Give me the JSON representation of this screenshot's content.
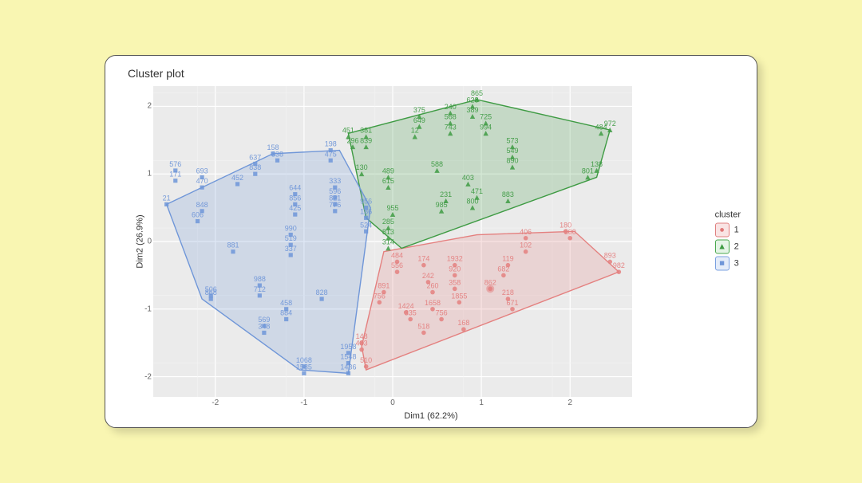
{
  "chart_data": {
    "type": "scatter",
    "title": "Cluster plot",
    "xlabel": "Dim1 (62.2%)",
    "ylabel": "Dim2 (26.9%)",
    "xlim": [
      -2.7,
      2.7
    ],
    "ylim": [
      -2.3,
      2.3
    ],
    "x_ticks": [
      -2,
      -1,
      0,
      1,
      2
    ],
    "y_ticks": [
      -2,
      -1,
      0,
      1,
      2
    ],
    "legend": {
      "title": "cluster",
      "items": [
        {
          "label": "1",
          "shape": "circle",
          "color": "#E4807F",
          "fill": "#F5C9C8"
        },
        {
          "label": "2",
          "shape": "triangle",
          "color": "#3E9B43",
          "fill": "#C6E6C8"
        },
        {
          "label": "3",
          "shape": "square",
          "color": "#6F96D8",
          "fill": "#C8D9F3"
        }
      ]
    },
    "hulls": {
      "1": [
        [
          -0.3,
          -1.9
        ],
        [
          2.55,
          -0.45
        ],
        [
          2.05,
          0.15
        ],
        [
          0.95,
          0.1
        ],
        [
          -0.1,
          -0.15
        ],
        [
          -0.35,
          -1.55
        ]
      ],
      "2": [
        [
          -0.5,
          1.6
        ],
        [
          0.95,
          2.1
        ],
        [
          2.45,
          1.65
        ],
        [
          2.3,
          0.95
        ],
        [
          0.1,
          -0.1
        ],
        [
          -0.3,
          0.35
        ]
      ],
      "3": [
        [
          -2.55,
          0.55
        ],
        [
          -1.35,
          1.3
        ],
        [
          -0.6,
          1.35
        ],
        [
          -0.25,
          0.5
        ],
        [
          -0.5,
          -1.95
        ],
        [
          -1.05,
          -1.9
        ],
        [
          -2.15,
          -0.85
        ]
      ]
    },
    "series": [
      {
        "name": "1",
        "color": "#E4807F",
        "shape": "circle",
        "points": [
          {
            "x": 0.05,
            "y": -0.3,
            "l": "484"
          },
          {
            "x": 0.05,
            "y": -0.45,
            "l": "556"
          },
          {
            "x": -0.1,
            "y": -0.75,
            "l": "891"
          },
          {
            "x": -0.15,
            "y": -0.9,
            "l": "756"
          },
          {
            "x": -0.35,
            "y": -1.5,
            "l": "148"
          },
          {
            "x": -0.35,
            "y": -1.6,
            "l": "483"
          },
          {
            "x": -0.3,
            "y": -1.85,
            "l": "510"
          },
          {
            "x": 0.15,
            "y": -1.05,
            "l": "1424"
          },
          {
            "x": 0.2,
            "y": -1.15,
            "l": "335"
          },
          {
            "x": 0.35,
            "y": -1.35,
            "l": "518"
          },
          {
            "x": 0.35,
            "y": -0.35,
            "l": "174"
          },
          {
            "x": 0.4,
            "y": -0.6,
            "l": "242"
          },
          {
            "x": 0.45,
            "y": -0.75,
            "l": "260"
          },
          {
            "x": 0.45,
            "y": -1.0,
            "l": "1658"
          },
          {
            "x": 0.55,
            "y": -1.15,
            "l": "756"
          },
          {
            "x": 0.7,
            "y": -0.35,
            "l": "1932"
          },
          {
            "x": 0.7,
            "y": -0.5,
            "l": "920"
          },
          {
            "x": 0.7,
            "y": -0.7,
            "l": "358"
          },
          {
            "x": 0.75,
            "y": -0.9,
            "l": "1855"
          },
          {
            "x": 0.8,
            "y": -1.3,
            "l": "168"
          },
          {
            "x": 1.1,
            "y": -0.7,
            "l": "862"
          },
          {
            "x": 1.25,
            "y": -0.5,
            "l": "682"
          },
          {
            "x": 1.3,
            "y": -0.35,
            "l": "119"
          },
          {
            "x": 1.3,
            "y": -0.85,
            "l": "218"
          },
          {
            "x": 1.35,
            "y": -1.0,
            "l": "671"
          },
          {
            "x": 1.5,
            "y": 0.05,
            "l": "406"
          },
          {
            "x": 1.5,
            "y": -0.15,
            "l": "102"
          },
          {
            "x": 1.95,
            "y": 0.15,
            "l": "180"
          },
          {
            "x": 2.0,
            "y": 0.05,
            "l": "300"
          },
          {
            "x": 2.45,
            "y": -0.3,
            "l": "893"
          },
          {
            "x": 2.55,
            "y": -0.45,
            "l": "982"
          }
        ]
      },
      {
        "name": "2",
        "color": "#3E9B43",
        "shape": "triangle",
        "points": [
          {
            "x": -0.05,
            "y": -0.1,
            "l": "314"
          },
          {
            "x": -0.05,
            "y": 0.05,
            "l": "813"
          },
          {
            "x": -0.05,
            "y": 0.2,
            "l": "285"
          },
          {
            "x": 0.0,
            "y": 0.4,
            "l": "955"
          },
          {
            "x": -0.05,
            "y": 0.8,
            "l": "615"
          },
          {
            "x": -0.05,
            "y": 0.95,
            "l": "489"
          },
          {
            "x": -0.35,
            "y": 1.0,
            "l": "130"
          },
          {
            "x": -0.3,
            "y": 1.4,
            "l": "839"
          },
          {
            "x": -0.3,
            "y": 1.55,
            "l": "381"
          },
          {
            "x": -0.45,
            "y": 1.4,
            "l": "296"
          },
          {
            "x": -0.5,
            "y": 1.55,
            "l": "451"
          },
          {
            "x": 0.25,
            "y": 1.55,
            "l": "12"
          },
          {
            "x": 0.3,
            "y": 1.7,
            "l": "649"
          },
          {
            "x": 0.3,
            "y": 1.85,
            "l": "375"
          },
          {
            "x": 0.5,
            "y": 1.05,
            "l": "588"
          },
          {
            "x": 0.55,
            "y": 0.45,
            "l": "985"
          },
          {
            "x": 0.6,
            "y": 0.6,
            "l": "231"
          },
          {
            "x": 0.65,
            "y": 1.75,
            "l": "568"
          },
          {
            "x": 0.65,
            "y": 1.9,
            "l": "240"
          },
          {
            "x": 0.65,
            "y": 1.6,
            "l": "743"
          },
          {
            "x": 0.85,
            "y": 0.85,
            "l": "403"
          },
          {
            "x": 0.9,
            "y": 1.85,
            "l": "389"
          },
          {
            "x": 0.9,
            "y": 2.0,
            "l": "628"
          },
          {
            "x": 0.95,
            "y": 2.1,
            "l": "865"
          },
          {
            "x": 0.9,
            "y": 0.5,
            "l": "800"
          },
          {
            "x": 0.95,
            "y": 0.65,
            "l": "471"
          },
          {
            "x": 1.05,
            "y": 1.6,
            "l": "994"
          },
          {
            "x": 1.05,
            "y": 1.75,
            "l": "725"
          },
          {
            "x": 1.3,
            "y": 0.6,
            "l": "883"
          },
          {
            "x": 1.35,
            "y": 1.25,
            "l": "549"
          },
          {
            "x": 1.35,
            "y": 1.4,
            "l": "573"
          },
          {
            "x": 1.35,
            "y": 1.1,
            "l": "890"
          },
          {
            "x": 2.2,
            "y": 0.95,
            "l": "801"
          },
          {
            "x": 2.3,
            "y": 1.05,
            "l": "138"
          },
          {
            "x": 2.35,
            "y": 1.6,
            "l": "484"
          },
          {
            "x": 2.45,
            "y": 1.65,
            "l": "972"
          }
        ]
      },
      {
        "name": "3",
        "color": "#6F96D8",
        "shape": "square",
        "points": [
          {
            "x": -2.55,
            "y": 0.55,
            "l": "21"
          },
          {
            "x": -2.45,
            "y": 0.9,
            "l": "171"
          },
          {
            "x": -2.45,
            "y": 1.05,
            "l": "576"
          },
          {
            "x": -2.15,
            "y": 0.8,
            "l": "470"
          },
          {
            "x": -2.15,
            "y": 0.95,
            "l": "693"
          },
          {
            "x": -2.2,
            "y": 0.3,
            "l": "606"
          },
          {
            "x": -2.15,
            "y": 0.45,
            "l": "848"
          },
          {
            "x": -2.05,
            "y": -0.8,
            "l": "506"
          },
          {
            "x": -2.05,
            "y": -0.85,
            "l": "868"
          },
          {
            "x": -1.8,
            "y": -0.15,
            "l": "881"
          },
          {
            "x": -1.75,
            "y": 0.85,
            "l": "452"
          },
          {
            "x": -1.55,
            "y": 1.0,
            "l": "838"
          },
          {
            "x": -1.55,
            "y": 1.15,
            "l": "637"
          },
          {
            "x": -1.5,
            "y": -0.65,
            "l": "988"
          },
          {
            "x": -1.5,
            "y": -0.8,
            "l": "712"
          },
          {
            "x": -1.45,
            "y": -1.25,
            "l": "569"
          },
          {
            "x": -1.45,
            "y": -1.35,
            "l": "348"
          },
          {
            "x": -1.35,
            "y": 1.3,
            "l": "158"
          },
          {
            "x": -1.3,
            "y": 1.2,
            "l": "338"
          },
          {
            "x": -1.1,
            "y": 0.55,
            "l": "856"
          },
          {
            "x": -1.1,
            "y": 0.7,
            "l": "644"
          },
          {
            "x": -1.1,
            "y": 0.4,
            "l": "425"
          },
          {
            "x": -1.15,
            "y": 0.1,
            "l": "990"
          },
          {
            "x": -1.15,
            "y": -0.05,
            "l": "519"
          },
          {
            "x": -1.15,
            "y": -0.2,
            "l": "337"
          },
          {
            "x": -1.2,
            "y": -1.0,
            "l": "458"
          },
          {
            "x": -1.2,
            "y": -1.15,
            "l": "884"
          },
          {
            "x": -1.0,
            "y": -1.85,
            "l": "1068"
          },
          {
            "x": -1.0,
            "y": -1.95,
            "l": "1585"
          },
          {
            "x": -0.8,
            "y": -0.85,
            "l": "828"
          },
          {
            "x": -0.7,
            "y": 1.35,
            "l": "198"
          },
          {
            "x": -0.7,
            "y": 1.2,
            "l": "475"
          },
          {
            "x": -0.65,
            "y": 0.8,
            "l": "333"
          },
          {
            "x": -0.65,
            "y": 0.65,
            "l": "596"
          },
          {
            "x": -0.65,
            "y": 0.55,
            "l": "821"
          },
          {
            "x": -0.65,
            "y": 0.45,
            "l": "776"
          },
          {
            "x": -0.5,
            "y": -1.65,
            "l": "1958"
          },
          {
            "x": -0.5,
            "y": -1.8,
            "l": "1548"
          },
          {
            "x": -0.5,
            "y": -1.95,
            "l": "1436"
          },
          {
            "x": -0.3,
            "y": 0.5,
            "l": "956"
          },
          {
            "x": -0.3,
            "y": 0.35,
            "l": "186"
          },
          {
            "x": -0.3,
            "y": 0.15,
            "l": "524"
          }
        ]
      }
    ]
  }
}
